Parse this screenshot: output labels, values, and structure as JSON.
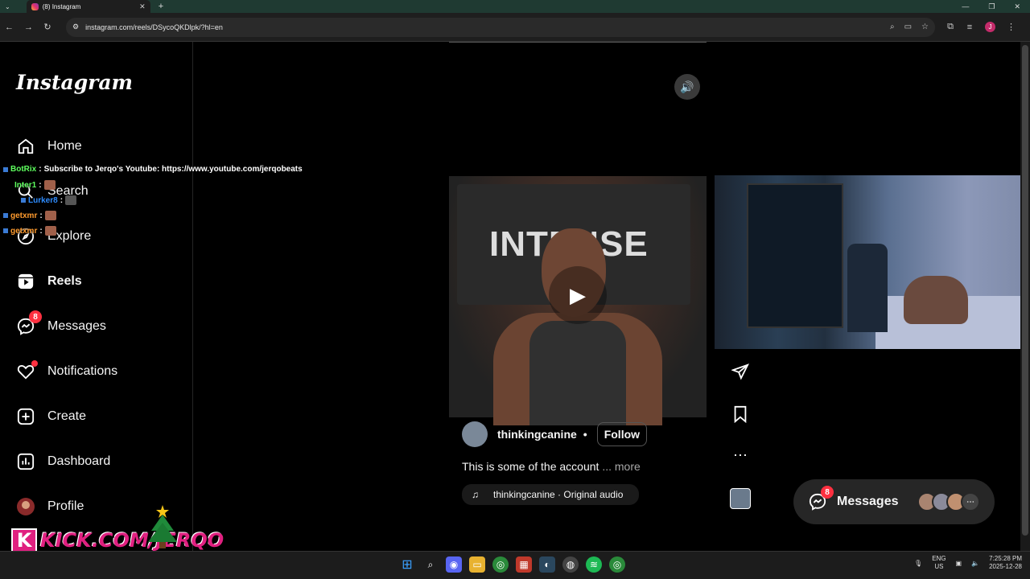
{
  "browser": {
    "tab_title": "(8) Instagram",
    "tab_close": "✕",
    "new_tab": "+",
    "window_controls": [
      "—",
      "❐",
      "✕"
    ],
    "url": "instagram.com/reels/DSycoQKDlpk/?hl=en",
    "profile_initial": "J"
  },
  "sidebar": {
    "logo": "Instagram",
    "items": [
      {
        "label": "Home",
        "icon": "home-icon"
      },
      {
        "label": "Search",
        "icon": "search-icon"
      },
      {
        "label": "Explore",
        "icon": "compass-icon"
      },
      {
        "label": "Reels",
        "icon": "reels-icon"
      },
      {
        "label": "Messages",
        "icon": "messenger-icon",
        "badge": "8"
      },
      {
        "label": "Notifications",
        "icon": "heart-icon"
      },
      {
        "label": "Create",
        "icon": "plus-square-icon"
      },
      {
        "label": "Dashboard",
        "icon": "dashboard-icon"
      },
      {
        "label": "Profile",
        "icon": "avatar-icon"
      }
    ]
  },
  "chat_overlay": [
    {
      "user": "BotRix",
      "sep": ":",
      "message": "Subscribe to Jerqo's Youtube: https://www.youtube.com/jerqobeats"
    },
    {
      "user": "Inter1",
      "sep": ":",
      "message": ""
    },
    {
      "user": "Lurker8",
      "sep": ":",
      "message": ""
    },
    {
      "user": "getxmr",
      "sep": ":",
      "message": ""
    },
    {
      "user": "getxmr",
      "sep": ":",
      "message": ""
    }
  ],
  "reel": {
    "banner_text": "INTENSE",
    "author": "thinkingcanine",
    "separator": "•",
    "follow_label": "Follow",
    "caption": "This is some of the account",
    "more_label": "... more",
    "audio": "thinkingcanine · Original audio"
  },
  "messages_pill": {
    "label": "Messages",
    "badge": "8",
    "more": "⋯"
  },
  "stream_overlay": {
    "kick_text": "KICK.COM/JERQO",
    "kick_letter": "K"
  },
  "taskbar": {
    "lang_top": "ENG",
    "lang_bottom": "US",
    "time": "7:25:28 PM",
    "date": "2025-12-28"
  },
  "colors": {
    "badge": "#ff3040",
    "kick": "#e02080",
    "tab_bar": "#1f3a32"
  }
}
